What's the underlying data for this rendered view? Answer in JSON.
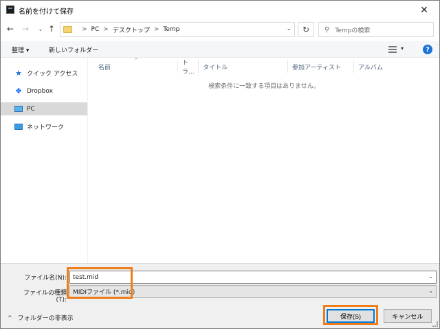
{
  "window": {
    "title": "名前を付けて保存",
    "close_glyph": "✕"
  },
  "nav": {
    "back_glyph": "←",
    "forward_glyph": "→",
    "recent_glyph": "⌄",
    "up_glyph": "↑",
    "breadcrumbs": [
      "PC",
      "デスクトップ",
      "Temp"
    ],
    "breadcrumb_sep": ">",
    "address_dropdown_glyph": "⌄",
    "refresh_glyph": "↻",
    "search_placeholder": "Tempの検索",
    "search_glyph": "⚲"
  },
  "toolbar": {
    "organize_label": "整理 ▾",
    "new_folder_label": "新しいフォルダー",
    "view_dropdown_glyph": "▾",
    "help_glyph": "?"
  },
  "sidebar": {
    "items": [
      {
        "label": "クイック アクセス",
        "icon": "star-icon",
        "glyph": "★"
      },
      {
        "label": "Dropbox",
        "icon": "dropbox-icon",
        "glyph": "❖"
      },
      {
        "label": "PC",
        "icon": "computer-icon",
        "glyph": ""
      },
      {
        "label": "ネットワーク",
        "icon": "network-icon",
        "glyph": ""
      }
    ],
    "selected": "PC"
  },
  "filelist": {
    "columns": [
      "名前",
      "トラ...",
      "タイトル",
      "参加アーティスト",
      "アルバム"
    ],
    "sort_glyph": "^",
    "empty_message": "検索条件に一致する項目はありません。"
  },
  "form": {
    "filename_label": "ファイル名(N):",
    "filename_value": "test.mid",
    "filetype_label": "ファイルの種類(T):",
    "filetype_value": "MIDIファイル (*.mid)",
    "dropdown_glyph": "⌄"
  },
  "footer": {
    "hide_folders_label": "フォルダーの非表示",
    "hide_folders_glyph": "^",
    "save_label": "保存(S)",
    "cancel_label": "キャンセル"
  },
  "colors": {
    "highlight": "#ee7d1a",
    "accent": "#0078d7"
  }
}
